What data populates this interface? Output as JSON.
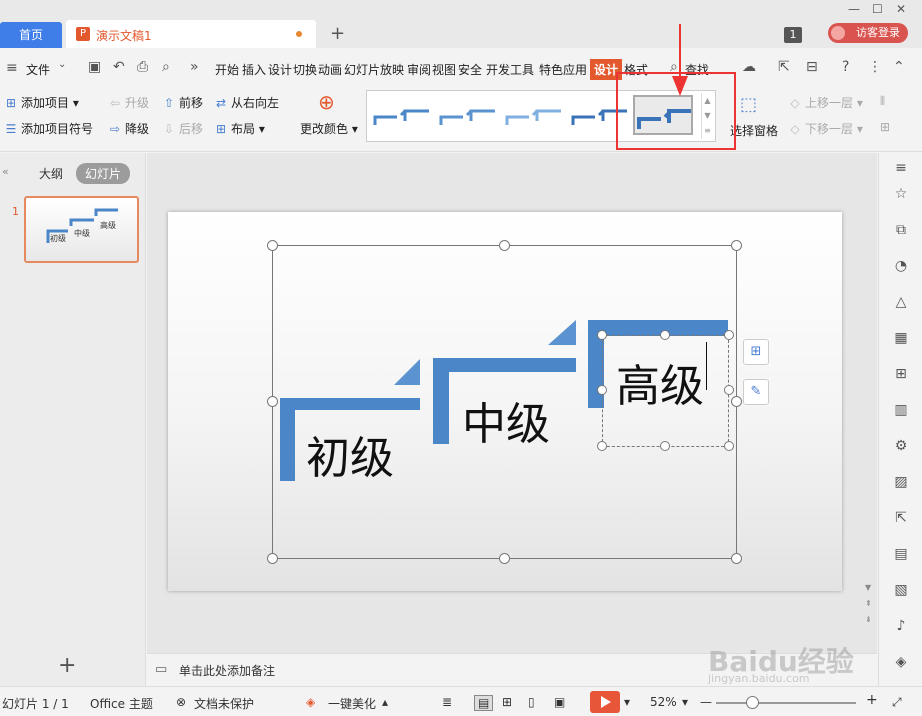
{
  "titlebar": {
    "home_tab": "首页",
    "doc_tab": "演示文稿1",
    "doc_icon_letter": "P",
    "add_tab": "+",
    "window_badge": "1",
    "login_label": "访客登录"
  },
  "menu": {
    "file": "文件",
    "items": [
      "开始",
      "插入",
      "设计",
      "切换",
      "动画",
      "幻灯片放映",
      "审阅",
      "视图",
      "安全",
      "开发工具",
      "特色应用",
      "设计",
      "格式"
    ],
    "active_item": "设计",
    "search": "查找"
  },
  "ribbon": {
    "add_item": "添加项目",
    "add_bullet": "添加项目符号",
    "promote": "升级",
    "demote": "降级",
    "move_forward": "前移",
    "move_backward": "后移",
    "right_to_left": "从右向左",
    "layout": "布局",
    "change_color": "更改颜色",
    "selection_pane": "选择窗格",
    "bring_forward": "上移一层",
    "send_backward": "下移一层"
  },
  "left_pane": {
    "outline_tab": "大纲",
    "slides_tab": "幻灯片",
    "slide_number": "1",
    "thumb_labels": [
      "初级",
      "中级",
      "高级"
    ],
    "add_slide": "+"
  },
  "slide": {
    "steps": [
      "初级",
      "中级",
      "高级"
    ],
    "accent_color": "#4a86c8"
  },
  "notes": {
    "placeholder": "单击此处添加备注"
  },
  "status": {
    "slide_count": "幻灯片 1 / 1",
    "theme": "Office 主题",
    "protection": "文档未保护",
    "beautify": "一键美化",
    "zoom": "52%",
    "zoom_minus": "—",
    "zoom_plus": "+"
  },
  "watermark": {
    "main": "Baidu经验",
    "sub": "jingyan.baidu.com"
  }
}
